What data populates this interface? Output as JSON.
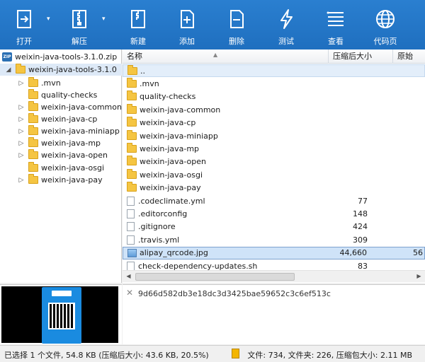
{
  "toolbar": {
    "buttons": [
      {
        "label": "打开",
        "icon": "open-icon"
      },
      {
        "label": "解压",
        "icon": "extract-icon"
      },
      {
        "label": "新建",
        "icon": "new-archive-icon"
      },
      {
        "label": "添加",
        "icon": "add-icon"
      },
      {
        "label": "删除",
        "icon": "delete-icon"
      },
      {
        "label": "测试",
        "icon": "test-icon"
      },
      {
        "label": "查看",
        "icon": "view-icon"
      },
      {
        "label": "代码页",
        "icon": "codepage-icon"
      }
    ]
  },
  "tree": {
    "archive": "weixin-java-tools-3.1.0.zip",
    "root": "weixin-java-tools-3.1.0",
    "children": [
      ".mvn",
      "quality-checks",
      "weixin-java-common",
      "weixin-java-cp",
      "weixin-java-miniapp",
      "weixin-java-mp",
      "weixin-java-open",
      "weixin-java-osgi",
      "weixin-java-pay"
    ]
  },
  "list": {
    "headers": {
      "name": "名称",
      "packed": "压缩后大小",
      "original": "原始"
    },
    "rows": [
      {
        "name": "..",
        "type": "up",
        "packed": "",
        "orig": ""
      },
      {
        "name": ".mvn",
        "type": "folder",
        "packed": "",
        "orig": ""
      },
      {
        "name": "quality-checks",
        "type": "folder",
        "packed": "",
        "orig": ""
      },
      {
        "name": "weixin-java-common",
        "type": "folder",
        "packed": "",
        "orig": ""
      },
      {
        "name": "weixin-java-cp",
        "type": "folder",
        "packed": "",
        "orig": ""
      },
      {
        "name": "weixin-java-miniapp",
        "type": "folder",
        "packed": "",
        "orig": ""
      },
      {
        "name": "weixin-java-mp",
        "type": "folder",
        "packed": "",
        "orig": ""
      },
      {
        "name": "weixin-java-open",
        "type": "folder",
        "packed": "",
        "orig": ""
      },
      {
        "name": "weixin-java-osgi",
        "type": "folder",
        "packed": "",
        "orig": ""
      },
      {
        "name": "weixin-java-pay",
        "type": "folder",
        "packed": "",
        "orig": ""
      },
      {
        "name": ".codeclimate.yml",
        "type": "file",
        "packed": "77",
        "orig": ""
      },
      {
        "name": ".editorconfig",
        "type": "file",
        "packed": "148",
        "orig": ""
      },
      {
        "name": ".gitignore",
        "type": "file",
        "packed": "424",
        "orig": ""
      },
      {
        "name": ".travis.yml",
        "type": "file",
        "packed": "309",
        "orig": ""
      },
      {
        "name": "alipay_qrcode.jpg",
        "type": "image",
        "packed": "44,660",
        "orig": "56",
        "selected": true
      },
      {
        "name": "check-dependency-updates.sh",
        "type": "file",
        "packed": "83",
        "orig": ""
      }
    ]
  },
  "info": {
    "hash": "9d66d582db3e18dc3d3425bae59652c3c6ef513c"
  },
  "status": {
    "left": "已选择 1 个文件, 54.8 KB (压缩后大小: 43.6 KB, 20.5%)",
    "right": "文件: 734, 文件夹: 226, 压缩包大小: 2.11 MB"
  }
}
